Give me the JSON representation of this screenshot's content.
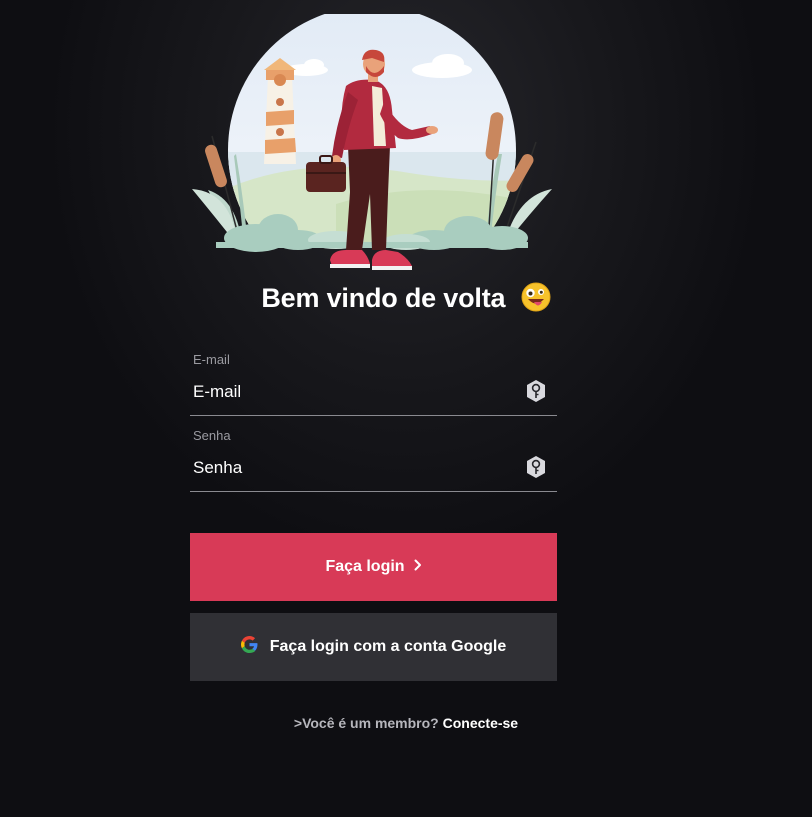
{
  "hero": {
    "illustration": "man-with-briefcase-lighthouse-illustration"
  },
  "welcome": {
    "title": "Bem vindo de volta",
    "emoji": "zany-face-emoji"
  },
  "form": {
    "email": {
      "label": "E-mail",
      "placeholder": "E-mail",
      "value": "",
      "icon": "key-icon"
    },
    "password": {
      "label": "Senha",
      "placeholder": "Senha",
      "value": "",
      "icon": "key-icon"
    }
  },
  "buttons": {
    "login": {
      "label": "Faça login",
      "icon": "chevron-right-icon"
    },
    "google": {
      "label": "Faça login com a conta Google",
      "icon": "google-icon"
    }
  },
  "footer": {
    "prompt": ">Você é um membro?",
    "link": "Conecte-se"
  },
  "colors": {
    "background": "#0e0e12",
    "primary_button": "#d83a57",
    "secondary_button": "#303035",
    "input_underline": "#8a8a90",
    "muted_text": "#9a9aa0"
  }
}
